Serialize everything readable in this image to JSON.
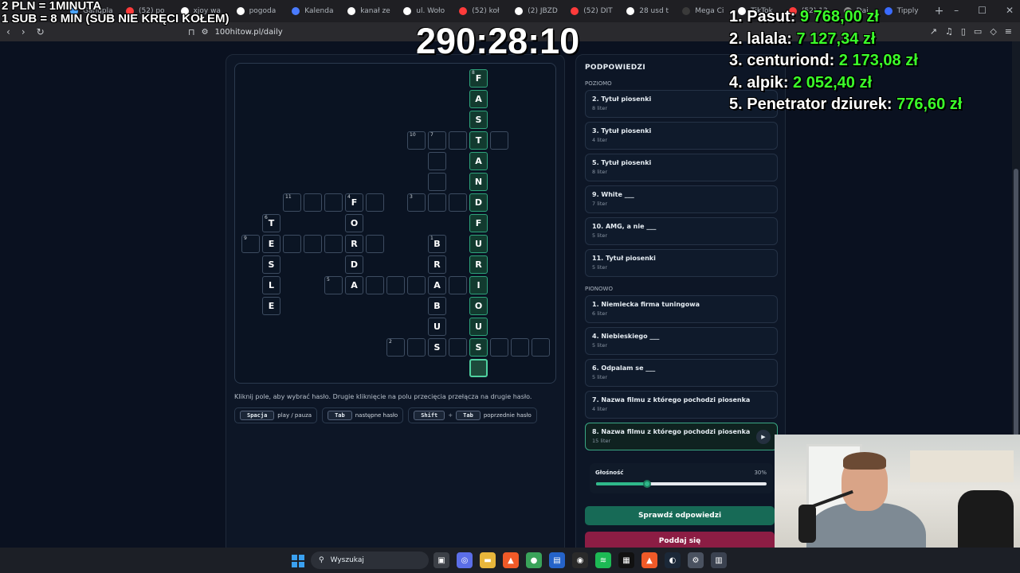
{
  "browser": {
    "tabs": [
      {
        "label": "Gangpla",
        "color": "#4aa3ff"
      },
      {
        "label": "(52) po",
        "color": "#ff3b3b"
      },
      {
        "label": "xjoy wa",
        "color": "#ffffff"
      },
      {
        "label": "pogoda",
        "color": "#ffffff"
      },
      {
        "label": "Kalenda",
        "color": "#4a7bff"
      },
      {
        "label": "kanał ze",
        "color": "#ffffff"
      },
      {
        "label": "ul. Woło",
        "color": "#ffffff"
      },
      {
        "label": "(52) koł",
        "color": "#ff3b3b"
      },
      {
        "label": "(2) JBZD",
        "color": "#ffffff"
      },
      {
        "label": "(52) DIT",
        "color": "#ff3b3b"
      },
      {
        "label": "28 usd t",
        "color": "#ffffff"
      },
      {
        "label": "Mega Ci",
        "color": "#3a3a3a"
      },
      {
        "label": "TikTok",
        "color": "#ffffff"
      },
      {
        "label": "(52) 13",
        "color": "#ff3b3b"
      },
      {
        "label": "Dai",
        "color": "#8a8a8a"
      },
      {
        "label": "Tipply",
        "color": "#3a6bff"
      }
    ],
    "url": "100hitow.pl/daily",
    "new_tab": "+"
  },
  "overlay": {
    "donation_line1": "2 PLN =  1MINUTA",
    "donation_line2": "1 SUB = 8 MIN (SUB NIE KRĘCI KOŁEM)",
    "timer": "290:28:10",
    "leaderboard": [
      {
        "rank_name": "1. Pasut:",
        "amount": "9 768,00 zł"
      },
      {
        "rank_name": "2. lalala:",
        "amount": "7 127,34 zł"
      },
      {
        "rank_name": "3. centuriond:",
        "amount": "2 173,08 zł"
      },
      {
        "rank_name": "4. alpik:",
        "amount": "2 052,40 zł"
      },
      {
        "rank_name": "5. Penetrator dziurek:",
        "amount": "776,60 zł"
      }
    ]
  },
  "crossword": {
    "instruction": "Kliknij pole, aby wybrać hasło. Drugie kliknięcie na polu przecięcia przełącza na drugie hasło.",
    "shortcuts": [
      {
        "keys": [
          "Spacja"
        ],
        "label": "play / pauza"
      },
      {
        "keys": [
          "Tab"
        ],
        "label": "następne hasło"
      },
      {
        "keys": [
          "Shift",
          "Tab"
        ],
        "label": "poprzednie hasło"
      }
    ],
    "plus": "+",
    "cells": [
      {
        "c": 11,
        "r": 0,
        "ch": "F",
        "n": "8",
        "hl": true
      },
      {
        "c": 11,
        "r": 1,
        "ch": "A",
        "n": "",
        "hl": true
      },
      {
        "c": 11,
        "r": 2,
        "ch": "S",
        "n": "",
        "hl": true
      },
      {
        "c": 8,
        "r": 3,
        "ch": "",
        "n": "10",
        "hl": false
      },
      {
        "c": 9,
        "r": 3,
        "ch": "",
        "n": "7",
        "hl": false
      },
      {
        "c": 10,
        "r": 3,
        "ch": "",
        "n": "",
        "hl": false
      },
      {
        "c": 11,
        "r": 3,
        "ch": "T",
        "n": "",
        "hl": true
      },
      {
        "c": 12,
        "r": 3,
        "ch": "",
        "n": "",
        "hl": false
      },
      {
        "c": 9,
        "r": 4,
        "ch": "",
        "n": "",
        "hl": false
      },
      {
        "c": 11,
        "r": 4,
        "ch": "A",
        "n": "",
        "hl": true
      },
      {
        "c": 9,
        "r": 5,
        "ch": "",
        "n": "",
        "hl": false
      },
      {
        "c": 11,
        "r": 5,
        "ch": "N",
        "n": "",
        "hl": true
      },
      {
        "c": 2,
        "r": 6,
        "ch": "",
        "n": "11",
        "hl": false
      },
      {
        "c": 3,
        "r": 6,
        "ch": "",
        "n": "",
        "hl": false
      },
      {
        "c": 4,
        "r": 6,
        "ch": "",
        "n": "",
        "hl": false
      },
      {
        "c": 5,
        "r": 6,
        "ch": "F",
        "n": "4",
        "hl": false
      },
      {
        "c": 6,
        "r": 6,
        "ch": "",
        "n": "",
        "hl": false
      },
      {
        "c": 8,
        "r": 6,
        "ch": "",
        "n": "3",
        "hl": false
      },
      {
        "c": 9,
        "r": 6,
        "ch": "",
        "n": "",
        "hl": false
      },
      {
        "c": 10,
        "r": 6,
        "ch": "",
        "n": "",
        "hl": false
      },
      {
        "c": 11,
        "r": 6,
        "ch": "D",
        "n": "",
        "hl": true
      },
      {
        "c": 1,
        "r": 7,
        "ch": "T",
        "n": "6",
        "hl": false
      },
      {
        "c": 5,
        "r": 7,
        "ch": "O",
        "n": "",
        "hl": false
      },
      {
        "c": 11,
        "r": 7,
        "ch": "F",
        "n": "",
        "hl": true
      },
      {
        "c": 0,
        "r": 8,
        "ch": "",
        "n": "9",
        "hl": false
      },
      {
        "c": 1,
        "r": 8,
        "ch": "E",
        "n": "",
        "hl": false
      },
      {
        "c": 2,
        "r": 8,
        "ch": "",
        "n": "",
        "hl": false
      },
      {
        "c": 3,
        "r": 8,
        "ch": "",
        "n": "",
        "hl": false
      },
      {
        "c": 4,
        "r": 8,
        "ch": "",
        "n": "",
        "hl": false
      },
      {
        "c": 5,
        "r": 8,
        "ch": "R",
        "n": "",
        "hl": false
      },
      {
        "c": 6,
        "r": 8,
        "ch": "",
        "n": "",
        "hl": false
      },
      {
        "c": 9,
        "r": 8,
        "ch": "B",
        "n": "1",
        "hl": false
      },
      {
        "c": 11,
        "r": 8,
        "ch": "U",
        "n": "",
        "hl": true
      },
      {
        "c": 1,
        "r": 9,
        "ch": "S",
        "n": "",
        "hl": false
      },
      {
        "c": 5,
        "r": 9,
        "ch": "D",
        "n": "",
        "hl": false
      },
      {
        "c": 9,
        "r": 9,
        "ch": "R",
        "n": "",
        "hl": false
      },
      {
        "c": 11,
        "r": 9,
        "ch": "R",
        "n": "",
        "hl": true
      },
      {
        "c": 1,
        "r": 10,
        "ch": "L",
        "n": "",
        "hl": false
      },
      {
        "c": 4,
        "r": 10,
        "ch": "",
        "n": "5",
        "hl": false
      },
      {
        "c": 5,
        "r": 10,
        "ch": "A",
        "n": "",
        "hl": false
      },
      {
        "c": 6,
        "r": 10,
        "ch": "",
        "n": "",
        "hl": false
      },
      {
        "c": 7,
        "r": 10,
        "ch": "",
        "n": "",
        "hl": false
      },
      {
        "c": 8,
        "r": 10,
        "ch": "",
        "n": "",
        "hl": false
      },
      {
        "c": 9,
        "r": 10,
        "ch": "A",
        "n": "",
        "hl": false
      },
      {
        "c": 10,
        "r": 10,
        "ch": "",
        "n": "",
        "hl": false
      },
      {
        "c": 11,
        "r": 10,
        "ch": "I",
        "n": "",
        "hl": true
      },
      {
        "c": 1,
        "r": 11,
        "ch": "E",
        "n": "",
        "hl": false
      },
      {
        "c": 9,
        "r": 11,
        "ch": "B",
        "n": "",
        "hl": false
      },
      {
        "c": 11,
        "r": 11,
        "ch": "O",
        "n": "",
        "hl": true
      },
      {
        "c": 9,
        "r": 12,
        "ch": "U",
        "n": "",
        "hl": false
      },
      {
        "c": 11,
        "r": 12,
        "ch": "U",
        "n": "",
        "hl": true
      },
      {
        "c": 7,
        "r": 13,
        "ch": "",
        "n": "2",
        "hl": false
      },
      {
        "c": 8,
        "r": 13,
        "ch": "",
        "n": "",
        "hl": false
      },
      {
        "c": 9,
        "r": 13,
        "ch": "S",
        "n": "",
        "hl": false
      },
      {
        "c": 10,
        "r": 13,
        "ch": "",
        "n": "",
        "hl": false
      },
      {
        "c": 11,
        "r": 13,
        "ch": "S",
        "n": "",
        "hl": true
      },
      {
        "c": 12,
        "r": 13,
        "ch": "",
        "n": "",
        "hl": false
      },
      {
        "c": 13,
        "r": 13,
        "ch": "",
        "n": "",
        "hl": false
      },
      {
        "c": 14,
        "r": 13,
        "ch": "",
        "n": "",
        "hl": false
      },
      {
        "c": 11,
        "r": 14,
        "ch": "",
        "n": "",
        "hl": true,
        "active": true
      }
    ]
  },
  "hints": {
    "title": "PODPOWIEDZI",
    "across_label": "POZIOMO",
    "down_label": "PIONOWO",
    "across": [
      {
        "title": "2. Tytuł piosenki",
        "len": "8 liter"
      },
      {
        "title": "3. Tytuł piosenki",
        "len": "4 liter"
      },
      {
        "title": "5. Tytuł piosenki",
        "len": "8 liter"
      },
      {
        "title": "9. White ___",
        "len": "7 liter"
      },
      {
        "title": "10. AMG, a nie ___",
        "len": "5 liter"
      },
      {
        "title": "11. Tytuł piosenki",
        "len": "5 liter"
      }
    ],
    "down": [
      {
        "title": "1. Niemiecka firma tuningowa",
        "len": "6 liter"
      },
      {
        "title": "4. Niebieskiego ___",
        "len": "5 liter"
      },
      {
        "title": "6. Odpalam se ___",
        "len": "5 liter"
      },
      {
        "title": "7. Nazwa filmu z którego pochodzi piosenka",
        "len": "4 liter"
      },
      {
        "title": "8. Nazwa filmu z którego pochodzi piosenka",
        "len": "15 liter",
        "active": true
      }
    ],
    "play_icon": "▶"
  },
  "volume": {
    "label": "Głośność",
    "value_text": "30%",
    "fraction": 0.3
  },
  "buttons": {
    "check": "Sprawdź odpowiedzi",
    "give_up": "Poddaj się"
  },
  "taskbar": {
    "search_placeholder": "Wyszukaj"
  },
  "colors": {
    "accent": "#2fb88a",
    "danger": "#8c1d44",
    "leaderboard_amount": "#3bff2a"
  }
}
